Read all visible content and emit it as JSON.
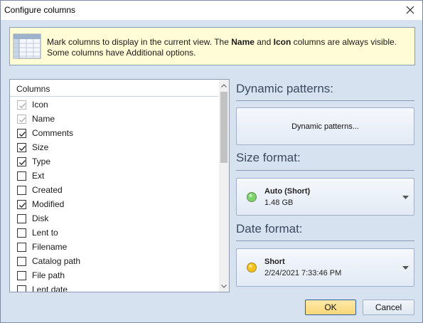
{
  "window": {
    "title": "Configure columns"
  },
  "info": {
    "text_before_name": "Mark columns to display in the current view. The ",
    "name_bold": "Name",
    "text_and": " and ",
    "icon_bold": "Icon",
    "text_after": " columns are always visible. Some columns have Additional options."
  },
  "columns_list": {
    "header": "Columns",
    "items": [
      {
        "label": "Icon",
        "checked": true,
        "disabled": true
      },
      {
        "label": "Name",
        "checked": true,
        "disabled": true
      },
      {
        "label": "Comments",
        "checked": true,
        "disabled": false
      },
      {
        "label": "Size",
        "checked": true,
        "disabled": false
      },
      {
        "label": "Type",
        "checked": true,
        "disabled": false
      },
      {
        "label": "Ext",
        "checked": false,
        "disabled": false
      },
      {
        "label": "Created",
        "checked": false,
        "disabled": false
      },
      {
        "label": "Modified",
        "checked": true,
        "disabled": false
      },
      {
        "label": "Disk",
        "checked": false,
        "disabled": false
      },
      {
        "label": "Lent to",
        "checked": false,
        "disabled": false
      },
      {
        "label": "Filename",
        "checked": false,
        "disabled": false
      },
      {
        "label": "Catalog path",
        "checked": false,
        "disabled": false
      },
      {
        "label": "File path",
        "checked": false,
        "disabled": false
      },
      {
        "label": "Lent date",
        "checked": false,
        "disabled": false
      }
    ]
  },
  "dynamic_patterns": {
    "title": "Dynamic patterns:",
    "button_label": "Dynamic patterns..."
  },
  "size_format": {
    "title": "Size format:",
    "value": "Auto (Short)",
    "example": "1.48 GB",
    "dot_color": "#7bd46a"
  },
  "date_format": {
    "title": "Date format:",
    "value": "Short",
    "example": "2/24/2021 7:33:46 PM",
    "dot_color": "#f5c21b"
  },
  "footer": {
    "ok_label": "OK",
    "cancel_label": "Cancel"
  },
  "icons": {
    "close": "close-icon",
    "info": "table-grid-icon",
    "scroll_up": "chevron-up-icon",
    "scroll_down": "chevron-down-icon",
    "dropdown": "dropdown-arrow-icon"
  },
  "colors": {
    "window_bg": "#d7e2f0",
    "info_bg": "#fffcd6",
    "ok_bg": "#fde9a8",
    "section_title": "#3a4a5e"
  }
}
